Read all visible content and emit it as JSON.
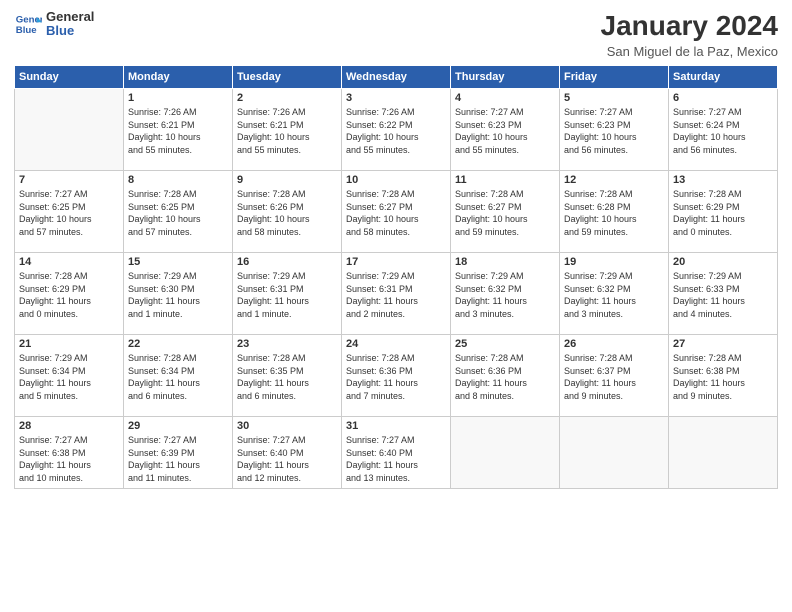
{
  "logo": {
    "line1": "General",
    "line2": "Blue"
  },
  "title": "January 2024",
  "location": "San Miguel de la Paz, Mexico",
  "weekdays": [
    "Sunday",
    "Monday",
    "Tuesday",
    "Wednesday",
    "Thursday",
    "Friday",
    "Saturday"
  ],
  "weeks": [
    [
      {
        "day": "",
        "info": ""
      },
      {
        "day": "1",
        "info": "Sunrise: 7:26 AM\nSunset: 6:21 PM\nDaylight: 10 hours\nand 55 minutes."
      },
      {
        "day": "2",
        "info": "Sunrise: 7:26 AM\nSunset: 6:21 PM\nDaylight: 10 hours\nand 55 minutes."
      },
      {
        "day": "3",
        "info": "Sunrise: 7:26 AM\nSunset: 6:22 PM\nDaylight: 10 hours\nand 55 minutes."
      },
      {
        "day": "4",
        "info": "Sunrise: 7:27 AM\nSunset: 6:23 PM\nDaylight: 10 hours\nand 55 minutes."
      },
      {
        "day": "5",
        "info": "Sunrise: 7:27 AM\nSunset: 6:23 PM\nDaylight: 10 hours\nand 56 minutes."
      },
      {
        "day": "6",
        "info": "Sunrise: 7:27 AM\nSunset: 6:24 PM\nDaylight: 10 hours\nand 56 minutes."
      }
    ],
    [
      {
        "day": "7",
        "info": "Sunrise: 7:27 AM\nSunset: 6:25 PM\nDaylight: 10 hours\nand 57 minutes."
      },
      {
        "day": "8",
        "info": "Sunrise: 7:28 AM\nSunset: 6:25 PM\nDaylight: 10 hours\nand 57 minutes."
      },
      {
        "day": "9",
        "info": "Sunrise: 7:28 AM\nSunset: 6:26 PM\nDaylight: 10 hours\nand 58 minutes."
      },
      {
        "day": "10",
        "info": "Sunrise: 7:28 AM\nSunset: 6:27 PM\nDaylight: 10 hours\nand 58 minutes."
      },
      {
        "day": "11",
        "info": "Sunrise: 7:28 AM\nSunset: 6:27 PM\nDaylight: 10 hours\nand 59 minutes."
      },
      {
        "day": "12",
        "info": "Sunrise: 7:28 AM\nSunset: 6:28 PM\nDaylight: 10 hours\nand 59 minutes."
      },
      {
        "day": "13",
        "info": "Sunrise: 7:28 AM\nSunset: 6:29 PM\nDaylight: 11 hours\nand 0 minutes."
      }
    ],
    [
      {
        "day": "14",
        "info": "Sunrise: 7:28 AM\nSunset: 6:29 PM\nDaylight: 11 hours\nand 0 minutes."
      },
      {
        "day": "15",
        "info": "Sunrise: 7:29 AM\nSunset: 6:30 PM\nDaylight: 11 hours\nand 1 minute."
      },
      {
        "day": "16",
        "info": "Sunrise: 7:29 AM\nSunset: 6:31 PM\nDaylight: 11 hours\nand 1 minute."
      },
      {
        "day": "17",
        "info": "Sunrise: 7:29 AM\nSunset: 6:31 PM\nDaylight: 11 hours\nand 2 minutes."
      },
      {
        "day": "18",
        "info": "Sunrise: 7:29 AM\nSunset: 6:32 PM\nDaylight: 11 hours\nand 3 minutes."
      },
      {
        "day": "19",
        "info": "Sunrise: 7:29 AM\nSunset: 6:32 PM\nDaylight: 11 hours\nand 3 minutes."
      },
      {
        "day": "20",
        "info": "Sunrise: 7:29 AM\nSunset: 6:33 PM\nDaylight: 11 hours\nand 4 minutes."
      }
    ],
    [
      {
        "day": "21",
        "info": "Sunrise: 7:29 AM\nSunset: 6:34 PM\nDaylight: 11 hours\nand 5 minutes."
      },
      {
        "day": "22",
        "info": "Sunrise: 7:28 AM\nSunset: 6:34 PM\nDaylight: 11 hours\nand 6 minutes."
      },
      {
        "day": "23",
        "info": "Sunrise: 7:28 AM\nSunset: 6:35 PM\nDaylight: 11 hours\nand 6 minutes."
      },
      {
        "day": "24",
        "info": "Sunrise: 7:28 AM\nSunset: 6:36 PM\nDaylight: 11 hours\nand 7 minutes."
      },
      {
        "day": "25",
        "info": "Sunrise: 7:28 AM\nSunset: 6:36 PM\nDaylight: 11 hours\nand 8 minutes."
      },
      {
        "day": "26",
        "info": "Sunrise: 7:28 AM\nSunset: 6:37 PM\nDaylight: 11 hours\nand 9 minutes."
      },
      {
        "day": "27",
        "info": "Sunrise: 7:28 AM\nSunset: 6:38 PM\nDaylight: 11 hours\nand 9 minutes."
      }
    ],
    [
      {
        "day": "28",
        "info": "Sunrise: 7:27 AM\nSunset: 6:38 PM\nDaylight: 11 hours\nand 10 minutes."
      },
      {
        "day": "29",
        "info": "Sunrise: 7:27 AM\nSunset: 6:39 PM\nDaylight: 11 hours\nand 11 minutes."
      },
      {
        "day": "30",
        "info": "Sunrise: 7:27 AM\nSunset: 6:40 PM\nDaylight: 11 hours\nand 12 minutes."
      },
      {
        "day": "31",
        "info": "Sunrise: 7:27 AM\nSunset: 6:40 PM\nDaylight: 11 hours\nand 13 minutes."
      },
      {
        "day": "",
        "info": ""
      },
      {
        "day": "",
        "info": ""
      },
      {
        "day": "",
        "info": ""
      }
    ]
  ]
}
